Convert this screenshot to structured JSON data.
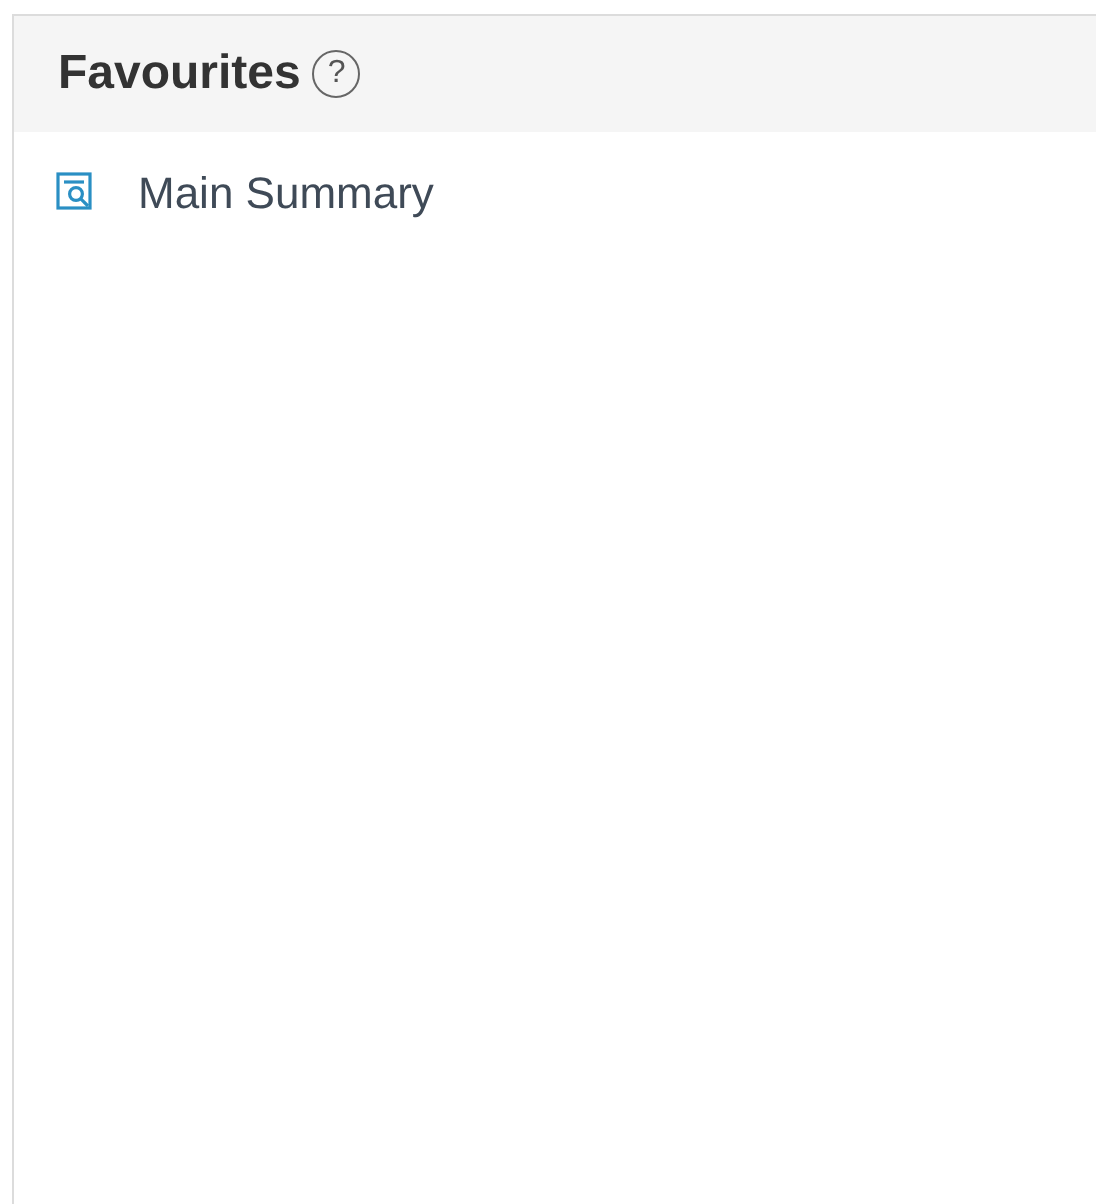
{
  "panel": {
    "title": "Favourites",
    "help": "?"
  },
  "items": [
    {
      "label": "Main Summary"
    }
  ]
}
